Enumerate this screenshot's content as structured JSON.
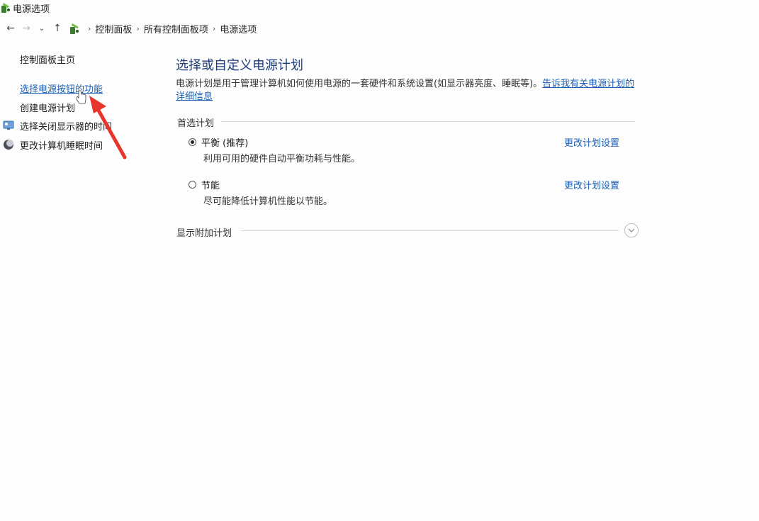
{
  "window": {
    "title": "电源选项"
  },
  "address": {
    "crumbs": [
      "控制面板",
      "所有控制面板项",
      "电源选项"
    ]
  },
  "sidebar": {
    "home": "控制面板主页",
    "items": [
      {
        "label": "选择电源按钮的功能",
        "icon": "none",
        "highlight": true
      },
      {
        "label": "创建电源计划",
        "icon": "none"
      },
      {
        "label": "选择关闭显示器的时间",
        "icon": "monitor-icon"
      },
      {
        "label": "更改计算机睡眠时间",
        "icon": "moon-icon"
      }
    ]
  },
  "main": {
    "title": "选择或自定义电源计划",
    "description": "电源计划是用于管理计算机如何使用电源的一套硬件和系统设置(如显示器亮度、睡眠等)。",
    "description_link": "告诉我有关电源计划的详细信息",
    "preferred_label": "首选计划",
    "plans": [
      {
        "name": "平衡 (推荐)",
        "desc": "利用可用的硬件自动平衡功耗与性能。",
        "selected": true,
        "link": "更改计划设置"
      },
      {
        "name": "节能",
        "desc": "尽可能降低计算机性能以节能。",
        "selected": false,
        "link": "更改计划设置"
      }
    ],
    "additional_label": "显示附加计划"
  },
  "colors": {
    "link": "#1a5fb4",
    "title": "#1f3d7a",
    "annotation_arrow": "#e8352b"
  }
}
